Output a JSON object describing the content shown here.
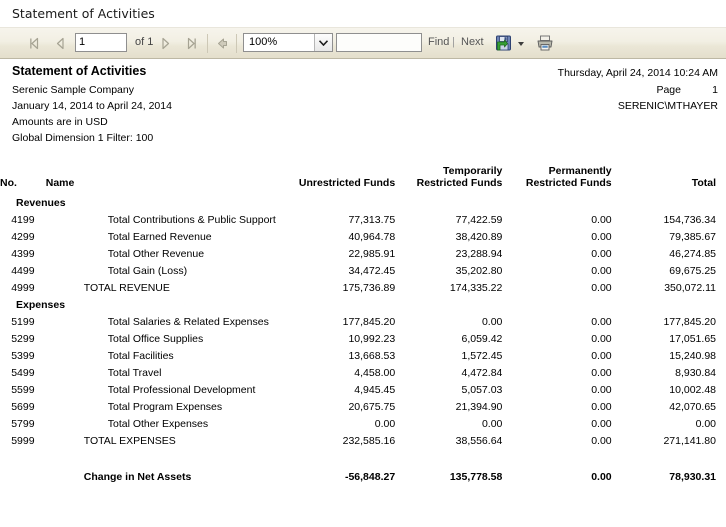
{
  "window": {
    "title": "Statement of Activities"
  },
  "toolbar": {
    "first_page_title": "First Page",
    "prev_page_title": "Previous Page",
    "page_value": "1",
    "of_label": "of 1",
    "next_page_title": "Next Page",
    "last_page_title": "Last Page",
    "back_title": "Back to Parent Report",
    "zoom_value": "100%",
    "find_value": "",
    "find_placeholder": "",
    "find_label": "Find",
    "pipe": "|",
    "next_label": "Next",
    "export_title": "Export",
    "print_title": "Print"
  },
  "report_header": {
    "title": "Statement of Activities",
    "company": "Serenic Sample Company",
    "period": "January 14, 2014 to April 24, 2014",
    "currency": "Amounts are in USD",
    "filter": "Global Dimension 1 Filter: 100",
    "datetime": "Thursday, April 24, 2014 10:24 AM",
    "page_label": "Page",
    "page_number": "1",
    "user": "SERENIC\\MTHAYER"
  },
  "table": {
    "columns": [
      {
        "key": "no",
        "label": "No."
      },
      {
        "key": "name",
        "label": "Name"
      },
      {
        "key": "unrestricted",
        "label": "Unrestricted Funds"
      },
      {
        "key": "temporarily",
        "label": "Temporarily\nRestricted Funds"
      },
      {
        "key": "permanently",
        "label": "Permanently\nRestricted Funds"
      },
      {
        "key": "total",
        "label": "Total"
      }
    ],
    "col_labels": {
      "no": "No.",
      "name": "Name",
      "unrestricted": "Unrestricted Funds",
      "temporarily_l1": "Temporarily",
      "temporarily_l2": "Restricted Funds",
      "permanently_l1": "Permanently",
      "permanently_l2": "Restricted Funds",
      "total": "Total"
    },
    "sections": [
      {
        "heading": "Revenues",
        "rows": [
          {
            "no": "4199",
            "name": "Total Contributions & Public Support",
            "unrestricted": "77,313.75",
            "temporarily": "77,422.59",
            "permanently": "0.00",
            "total": "154,736.34",
            "type": "detail"
          },
          {
            "no": "4299",
            "name": "Total Earned Revenue",
            "unrestricted": "40,964.78",
            "temporarily": "38,420.89",
            "permanently": "0.00",
            "total": "79,385.67",
            "type": "detail"
          },
          {
            "no": "4399",
            "name": "Total Other Revenue",
            "unrestricted": "22,985.91",
            "temporarily": "23,288.94",
            "permanently": "0.00",
            "total": "46,274.85",
            "type": "detail"
          },
          {
            "no": "4499",
            "name": "Total Gain (Loss)",
            "unrestricted": "34,472.45",
            "temporarily": "35,202.80",
            "permanently": "0.00",
            "total": "69,675.25",
            "type": "detail"
          },
          {
            "no": "4999",
            "name": "TOTAL REVENUE",
            "unrestricted": "175,736.89",
            "temporarily": "174,335.22",
            "permanently": "0.00",
            "total": "350,072.11",
            "type": "grand"
          }
        ]
      },
      {
        "heading": "Expenses",
        "rows": [
          {
            "no": "5199",
            "name": "Total Salaries & Related Expenses",
            "unrestricted": "177,845.20",
            "temporarily": "0.00",
            "permanently": "0.00",
            "total": "177,845.20",
            "type": "detail"
          },
          {
            "no": "5299",
            "name": "Total Office Supplies",
            "unrestricted": "10,992.23",
            "temporarily": "6,059.42",
            "permanently": "0.00",
            "total": "17,051.65",
            "type": "detail"
          },
          {
            "no": "5399",
            "name": "Total Facilities",
            "unrestricted": "13,668.53",
            "temporarily": "1,572.45",
            "permanently": "0.00",
            "total": "15,240.98",
            "type": "detail"
          },
          {
            "no": "5499",
            "name": "Total Travel",
            "unrestricted": "4,458.00",
            "temporarily": "4,472.84",
            "permanently": "0.00",
            "total": "8,930.84",
            "type": "detail"
          },
          {
            "no": "5599",
            "name": "Total Professional Development",
            "unrestricted": "4,945.45",
            "temporarily": "5,057.03",
            "permanently": "0.00",
            "total": "10,002.48",
            "type": "detail"
          },
          {
            "no": "5699",
            "name": "Total Program Expenses",
            "unrestricted": "20,675.75",
            "temporarily": "21,394.90",
            "permanently": "0.00",
            "total": "42,070.65",
            "type": "detail"
          },
          {
            "no": "5799",
            "name": "Total Other Expenses",
            "unrestricted": "0.00",
            "temporarily": "0.00",
            "permanently": "0.00",
            "total": "0.00",
            "type": "detail"
          },
          {
            "no": "5999",
            "name": "TOTAL EXPENSES",
            "unrestricted": "232,585.16",
            "temporarily": "38,556.64",
            "permanently": "0.00",
            "total": "271,141.80",
            "type": "grand"
          }
        ]
      }
    ],
    "net_row": {
      "no": "",
      "name": "Change in Net Assets",
      "unrestricted": "-56,848.27",
      "temporarily": "135,778.58",
      "permanently": "0.00",
      "total": "78,930.31"
    }
  },
  "colors": {
    "toolbar_top": "#f6f4ec",
    "toolbar_bottom": "#e4dfcc",
    "toolbar_border": "#bdb8a4",
    "text": "#000000",
    "muted_text": "#555555",
    "export_icon_body": "#4f6fa8",
    "export_icon_arrow": "#3ba33b"
  }
}
